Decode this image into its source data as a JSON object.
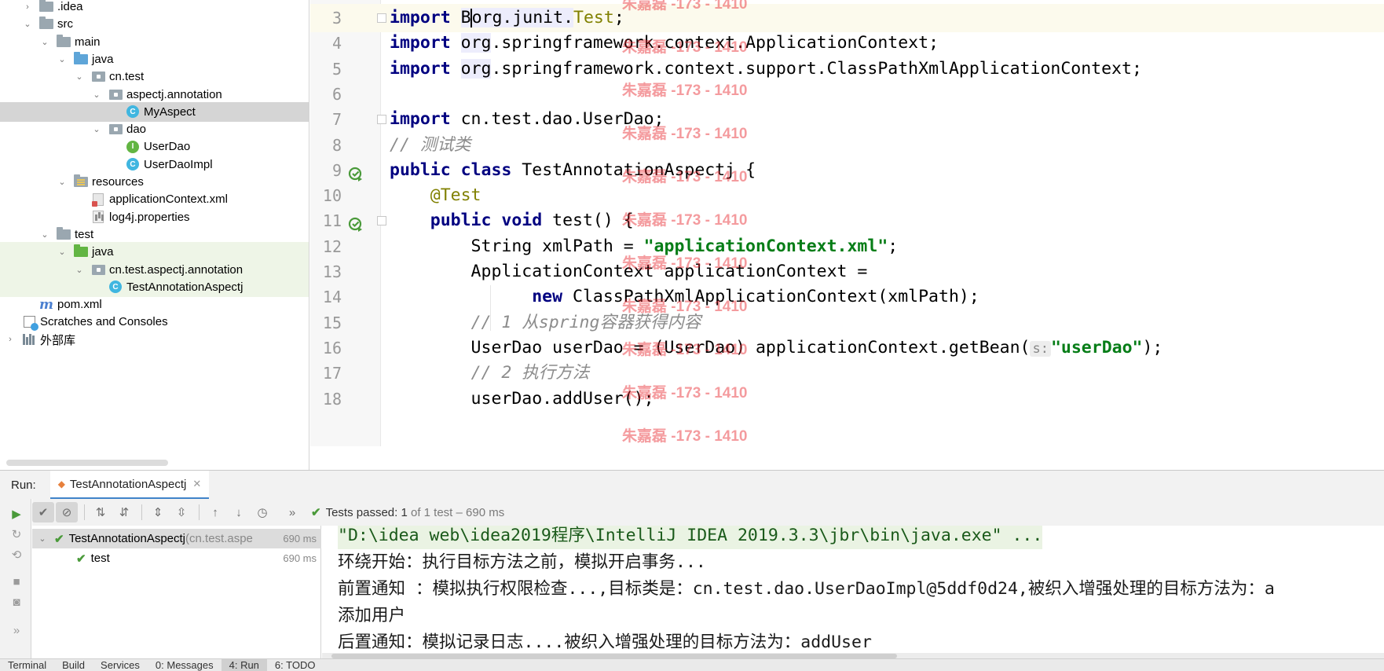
{
  "project_tree": {
    "items": [
      {
        "label": ".idea",
        "type": "folder",
        "depth": 1,
        "state": "collapsed"
      },
      {
        "label": "src",
        "type": "folder",
        "depth": 1,
        "state": "expanded"
      },
      {
        "label": "main",
        "type": "folder",
        "depth": 2,
        "state": "expanded"
      },
      {
        "label": "java",
        "type": "folder-blue",
        "depth": 3,
        "state": "expanded"
      },
      {
        "label": "cn.test",
        "type": "package",
        "depth": 4,
        "state": "expanded"
      },
      {
        "label": "aspectj.annotation",
        "type": "package",
        "depth": 5,
        "state": "expanded"
      },
      {
        "label": "MyAspect",
        "type": "class",
        "depth": 6,
        "selected": true
      },
      {
        "label": "dao",
        "type": "package",
        "depth": 5,
        "state": "expanded"
      },
      {
        "label": "UserDao",
        "type": "interface",
        "depth": 6
      },
      {
        "label": "UserDaoImpl",
        "type": "class",
        "depth": 6
      },
      {
        "label": "resources",
        "type": "resources",
        "depth": 3,
        "state": "expanded"
      },
      {
        "label": "applicationContext.xml",
        "type": "xml",
        "depth": 4
      },
      {
        "label": "log4j.properties",
        "type": "properties",
        "depth": 4
      },
      {
        "label": "test",
        "type": "folder",
        "depth": 2,
        "state": "expanded"
      },
      {
        "label": "java",
        "type": "folder-green",
        "depth": 3,
        "state": "expanded",
        "test": true
      },
      {
        "label": "cn.test.aspectj.annotation",
        "type": "package",
        "depth": 4,
        "state": "expanded",
        "test": true
      },
      {
        "label": "TestAnnotationAspectj",
        "type": "class",
        "depth": 5,
        "test": true
      },
      {
        "label": "pom.xml",
        "type": "maven",
        "depth": 1
      },
      {
        "label": "Scratches and Consoles",
        "type": "scratch",
        "depth": 0
      },
      {
        "label": "外部库",
        "type": "libraries",
        "depth": 0,
        "state": "collapsed"
      }
    ]
  },
  "editor": {
    "lines": [
      {
        "num": "3",
        "tokens": [
          {
            "t": "import",
            "c": "kw"
          },
          {
            "t": " "
          },
          {
            "t": "B",
            "c": "imp-pkg"
          },
          {
            "t": "|caret|"
          },
          {
            "t": "org.junit.",
            "c": "imp-pkg"
          },
          {
            "t": "Test",
            "c": "cls-ref"
          },
          {
            "t": ";"
          }
        ],
        "current": true,
        "fold": true
      },
      {
        "num": "4",
        "tokens": [
          {
            "t": "import",
            "c": "kw"
          },
          {
            "t": " "
          },
          {
            "t": "org",
            "c": "imp-pkg"
          },
          {
            "t": ".springframework.context.ApplicationContext;"
          }
        ]
      },
      {
        "num": "5",
        "tokens": [
          {
            "t": "import",
            "c": "kw"
          },
          {
            "t": " "
          },
          {
            "t": "org",
            "c": "imp-pkg"
          },
          {
            "t": ".springframework.context.support.ClassPathXmlApplicationContext;"
          }
        ]
      },
      {
        "num": "6",
        "tokens": []
      },
      {
        "num": "7",
        "tokens": [
          {
            "t": "import",
            "c": "kw"
          },
          {
            "t": " cn.test.dao.UserDao;"
          }
        ],
        "fold": true
      },
      {
        "num": "8",
        "tokens": [
          {
            "t": "// 测试类",
            "c": "cm"
          }
        ]
      },
      {
        "num": "9",
        "tokens": [
          {
            "t": "public",
            "c": "kw"
          },
          {
            "t": " "
          },
          {
            "t": "class",
            "c": "kw"
          },
          {
            "t": " TestAnnotationAspectj {"
          }
        ],
        "run": true
      },
      {
        "num": "10",
        "tokens": [
          {
            "t": "    "
          },
          {
            "t": "@Test",
            "c": "ann"
          }
        ]
      },
      {
        "num": "11",
        "tokens": [
          {
            "t": "    "
          },
          {
            "t": "public",
            "c": "kw"
          },
          {
            "t": " "
          },
          {
            "t": "void",
            "c": "kw"
          },
          {
            "t": " test() {"
          }
        ],
        "run": true,
        "fold": true
      },
      {
        "num": "12",
        "tokens": [
          {
            "t": "        String xmlPath = "
          },
          {
            "t": "\"applicationContext.xml\"",
            "c": "str"
          },
          {
            "t": ";"
          }
        ]
      },
      {
        "num": "13",
        "tokens": [
          {
            "t": "        ApplicationContext applicationContext ="
          }
        ]
      },
      {
        "num": "14",
        "tokens": [
          {
            "t": "              "
          },
          {
            "t": "new",
            "c": "kw"
          },
          {
            "t": " ClassPathXmlApplicationContext(xmlPath);"
          }
        ]
      },
      {
        "num": "15",
        "tokens": [
          {
            "t": "        "
          },
          {
            "t": "// 1 从spring容器获得内容",
            "c": "cm"
          }
        ]
      },
      {
        "num": "16",
        "tokens": [
          {
            "t": "        UserDao userDao = (UserDao) applicationContext.getBean("
          },
          {
            "t": "s:",
            "c": "hint"
          },
          {
            "t": "\"userDao\"",
            "c": "str"
          },
          {
            "t": ");"
          }
        ]
      },
      {
        "num": "17",
        "tokens": [
          {
            "t": "        "
          },
          {
            "t": "// 2 执行方法",
            "c": "cm"
          }
        ]
      },
      {
        "num": "18",
        "tokens": [
          {
            "t": "        userDao.addUser();"
          }
        ]
      }
    ]
  },
  "watermark": {
    "text": "朱嘉磊 -173 - 1410",
    "count": 16
  },
  "run_panel": {
    "label": "Run:",
    "tab_label": "TestAnnotationAspectj",
    "status_prefix": "Tests passed:",
    "status_count": "1",
    "status_rest": "of 1 test – 690 ms",
    "tests": [
      {
        "name": "TestAnnotationAspectj",
        "pkg": "(cn.test.aspe",
        "duration": "690 ms",
        "depth": 0,
        "selected": true
      },
      {
        "name": "test",
        "pkg": "",
        "duration": "690 ms",
        "depth": 1,
        "selected": false
      }
    ],
    "console": [
      {
        "text": "\"D:\\idea web\\idea2019程序\\IntelliJ IDEA 2019.3.3\\jbr\\bin\\java.exe\" ...",
        "cmd": true
      },
      {
        "text": "环绕开始：执行目标方法之前，模拟开启事务..."
      },
      {
        "text": "前置通知 ：模拟执行权限检查...,目标类是：cn.test.dao.UserDaoImpl@5ddf0d24,被织入增强处理的目标方法为：a"
      },
      {
        "text": "添加用户"
      },
      {
        "text": "后置通知：模拟记录日志....被织入增强处理的目标方法为：addUser"
      }
    ]
  },
  "bottom_bar": {
    "items": [
      "Terminal",
      "Build",
      "Services",
      "0: Messages",
      "4: Run",
      "6: TODO"
    ],
    "active": "4: Run"
  },
  "colors": {
    "keyword": "#000080",
    "string": "#067d17",
    "comment": "#8c8c8c",
    "annotation": "#808000",
    "pass_green": "#4a9a3a",
    "watermark_red": "#e8232b"
  }
}
